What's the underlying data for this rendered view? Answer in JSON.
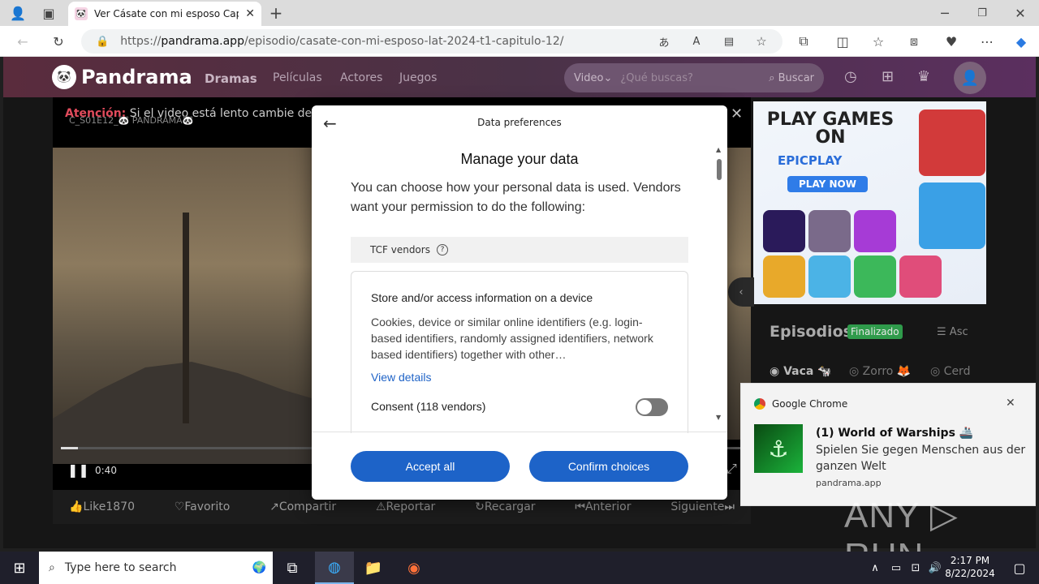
{
  "browser": {
    "tab_title": "Ver Cásate con mi esposo Capítul",
    "url_prefix": "https://",
    "url_host": "pandrama.app",
    "url_path": "/episodio/casate-con-mi-esposo-lat-2024-t1-capitulo-12/"
  },
  "site": {
    "logo": "Pandrama",
    "nav": [
      "Dramas",
      "Películas",
      "Actores",
      "Juegos"
    ],
    "search_filter": "Video",
    "search_placeholder": "¿Qué buscas?",
    "search_button": "Buscar"
  },
  "player": {
    "attention_label": "Atención:",
    "attention_text": "Si el video está lento cambie de serv",
    "watermark": "C_S01E12_🐼 PANDRAMA🐼",
    "time": "0:40",
    "progress": 0.025,
    "actions": [
      "Like1870",
      "Favorito",
      "Compartir",
      "Reportar",
      "Recargar",
      "Anterior",
      "Siguiente"
    ]
  },
  "ad": {
    "headline": "PLAY GAMES ON",
    "brand": "EPICPLAY",
    "cta": "PLAY NOW"
  },
  "episodes": {
    "title": "Episodios",
    "status": "Finalizado",
    "sort": "Asc",
    "seasons": [
      "Vaca 🐄",
      "Zorro 🦊",
      "Cerd"
    ]
  },
  "modal": {
    "header": "Data preferences",
    "title": "Manage your data",
    "description": "You can choose how your personal data is used. Vendors want your permission to do the following:",
    "section_label": "TCF vendors",
    "purpose_title": "Store and/or access information on a device",
    "purpose_desc": "Cookies, device or similar online identifiers (e.g. login-based identifiers, randomly assigned identifiers, network based identifiers) together with other…",
    "view_details": "View details",
    "consent_label": "Consent (118 vendors)",
    "accept_all": "Accept all",
    "confirm": "Confirm choices"
  },
  "notification": {
    "app": "Google Chrome",
    "title": "(1) World of Warships 🚢",
    "body": "Spielen Sie gegen Menschen aus der ganzen Welt",
    "source": "pandrama.app"
  },
  "taskbar": {
    "search_placeholder": "Type here to search",
    "time": "2:17 PM",
    "date": "8/22/2024"
  },
  "watermark_text": "ANY ▷ RUN"
}
